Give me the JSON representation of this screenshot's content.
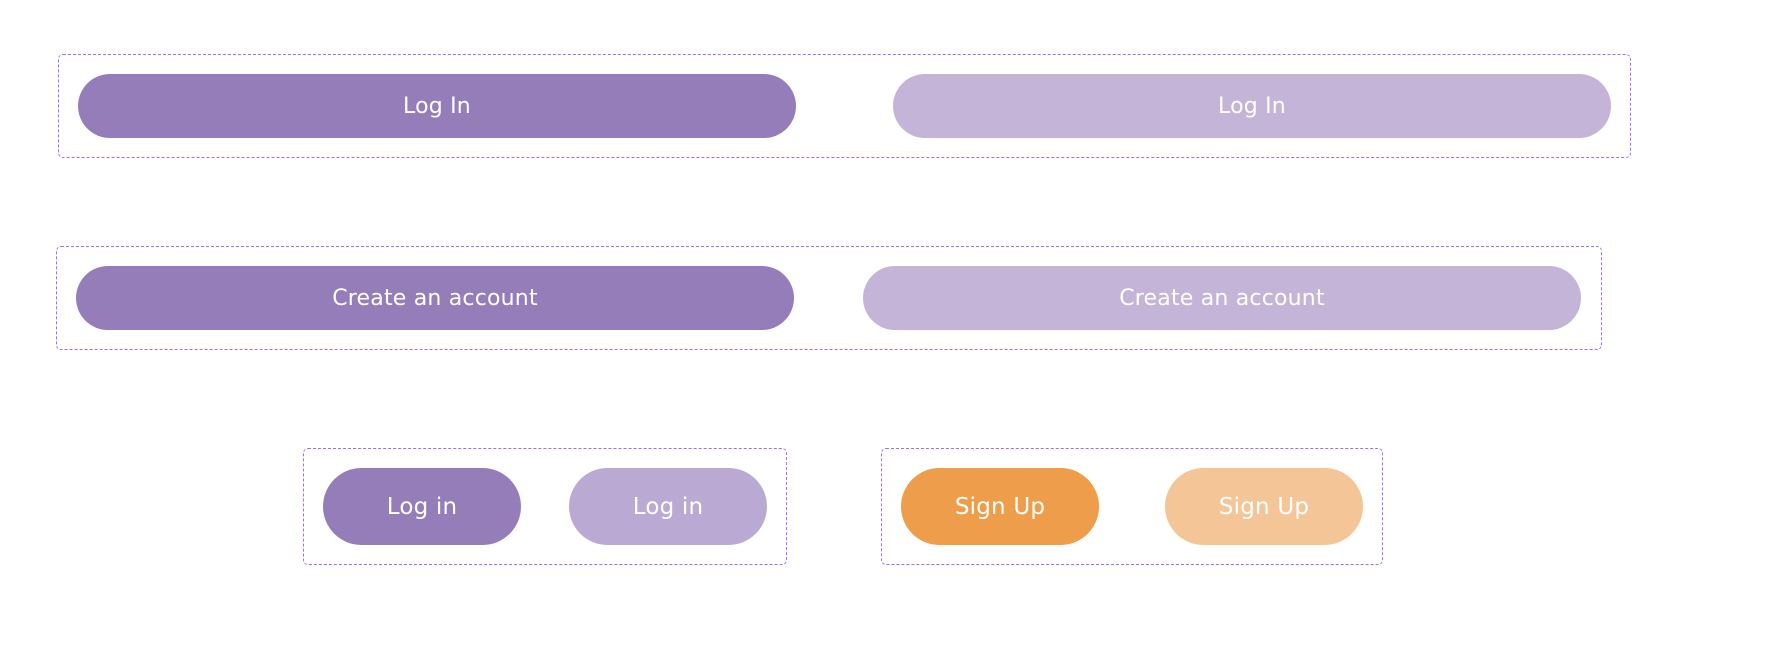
{
  "colors": {
    "group_border": "#9d6ef5",
    "primary_purple": "#957dba",
    "disabled_purple_wide": "#c3b4d8",
    "disabled_purple_small": "#baaad3",
    "primary_orange": "#ee9d4b",
    "disabled_orange": "#f4c597",
    "text": "#ffffff"
  },
  "groups": {
    "login_wide": {
      "default_label": "Log In",
      "disabled_label": "Log In"
    },
    "create_account": {
      "default_label": "Create an account",
      "disabled_label": "Create an account"
    },
    "login_small": {
      "default_label": "Log in",
      "disabled_label": "Log in"
    },
    "signup_small": {
      "default_label": "Sign Up",
      "disabled_label": "Sign Up"
    }
  }
}
